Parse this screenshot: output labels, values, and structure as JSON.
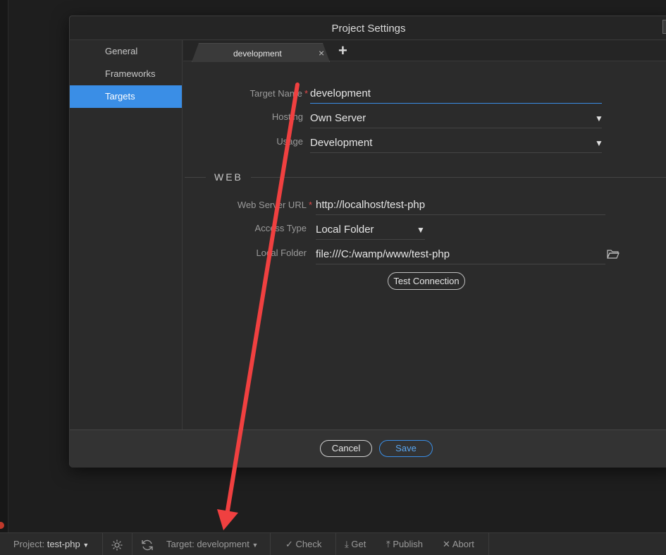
{
  "dialog": {
    "title": "Project Settings",
    "close_icon": "close-icon"
  },
  "sidebar": {
    "items": [
      {
        "label": "General"
      },
      {
        "label": "Frameworks"
      },
      {
        "label": "Targets"
      }
    ],
    "active": "Targets"
  },
  "tabs": {
    "items": [
      {
        "label": "development"
      }
    ],
    "close_glyph": "×",
    "add_glyph": "+"
  },
  "form": {
    "target_name": {
      "label": "Target Name",
      "value": "development",
      "required": "*"
    },
    "hosting": {
      "label": "Hosting",
      "value": "Own Server"
    },
    "usage": {
      "label": "Usage",
      "value": "Development"
    },
    "section_web": "WEB",
    "web_server_url": {
      "label": "Web Server URL",
      "value": "http://localhost/test-php",
      "required": "*"
    },
    "access_type": {
      "label": "Access Type",
      "value": "Local Folder"
    },
    "local_folder": {
      "label": "Local Folder",
      "value": "file:///C:/wamp/www/test-php"
    },
    "test_connection": "Test Connection"
  },
  "footer": {
    "cancel": "Cancel",
    "save": "Save"
  },
  "statusbar": {
    "project_label": "Project:",
    "project_value": "test-php",
    "target_label": "Target:",
    "target_value": "development",
    "check": "Check",
    "get": "Get",
    "publish": "Publish",
    "abort": "Abort"
  },
  "colors": {
    "accent": "#3a8ee6",
    "required": "#e04848",
    "annotation_arrow": "#f04040"
  },
  "icons": [
    "close-icon",
    "plus-icon",
    "dropdown-caret-icon",
    "folder-icon",
    "gear-icon",
    "refresh-icon",
    "check-icon",
    "download-icon",
    "upload-icon",
    "abort-icon"
  ]
}
